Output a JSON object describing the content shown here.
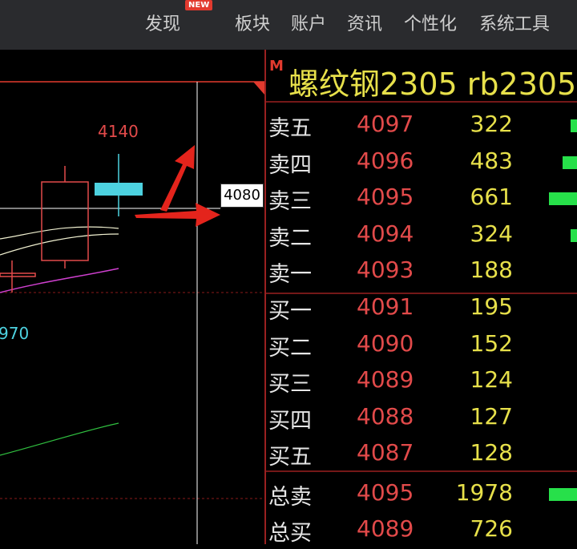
{
  "menu": {
    "discover": "发现",
    "new_badge": "NEW",
    "sectors": "板块",
    "account": "账户",
    "news": "资讯",
    "personalize": "个性化",
    "tools": "系统工具"
  },
  "chart": {
    "high_label": "4140",
    "low_label": "970",
    "price_tag": "4080"
  },
  "quote": {
    "marker": "M",
    "title": "螺纹钢2305   rb2305"
  },
  "asks": [
    {
      "label": "卖五",
      "price": "4097",
      "volume": "322"
    },
    {
      "label": "卖四",
      "price": "4096",
      "volume": "483"
    },
    {
      "label": "卖三",
      "price": "4095",
      "volume": "661"
    },
    {
      "label": "卖二",
      "price": "4094",
      "volume": "324"
    },
    {
      "label": "卖一",
      "price": "4093",
      "volume": "188"
    }
  ],
  "bids": [
    {
      "label": "买一",
      "price": "4091",
      "volume": "195"
    },
    {
      "label": "买二",
      "price": "4090",
      "volume": "152"
    },
    {
      "label": "买三",
      "price": "4089",
      "volume": "124"
    },
    {
      "label": "买四",
      "price": "4088",
      "volume": "127"
    },
    {
      "label": "买五",
      "price": "4087",
      "volume": "128"
    }
  ],
  "totals": [
    {
      "label": "总卖",
      "price": "4095",
      "volume": "1978"
    },
    {
      "label": "总买",
      "price": "4089",
      "volume": "726"
    }
  ],
  "colors": {
    "up": "#e24a4a",
    "volume": "#e7e04a",
    "bar": "#27e04a",
    "accent": "#e23a2e"
  }
}
